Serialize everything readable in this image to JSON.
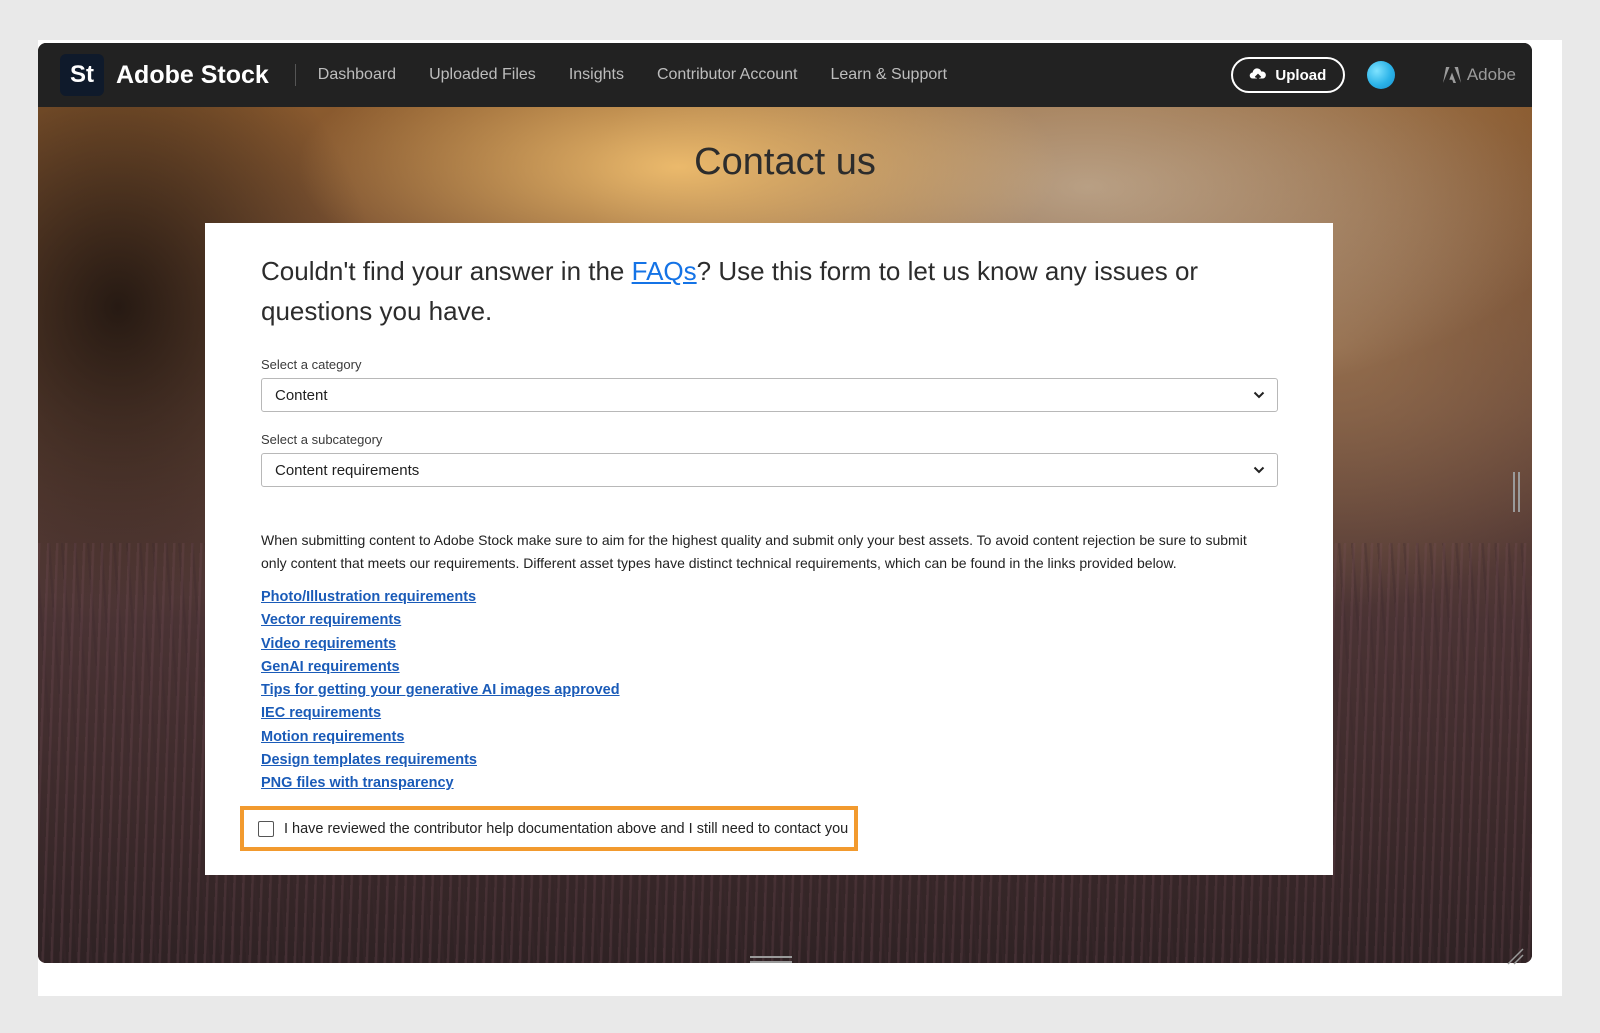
{
  "header": {
    "logo_text": "St",
    "brand": "Adobe Stock",
    "nav": [
      "Dashboard",
      "Uploaded Files",
      "Insights",
      "Contributor Account",
      "Learn & Support"
    ],
    "upload_label": "Upload",
    "adobe_label": "Adobe"
  },
  "page": {
    "title": "Contact us"
  },
  "form": {
    "intro_before": "Couldn't find your answer in the ",
    "intro_link": "FAQs",
    "intro_after": "? Use this form to let us know any issues or questions you have.",
    "category_label": "Select a category",
    "category_value": "Content",
    "subcategory_label": "Select a subcategory",
    "subcategory_value": "Content requirements",
    "description": "When submitting content to Adobe Stock make sure to aim for the highest quality and submit only your best assets. To avoid content rejection be sure to submit only content that meets our requirements. Different asset types have distinct technical requirements, which can be found in the links provided below.",
    "links": [
      "Photo/Illustration requirements",
      "Vector requirements",
      "Video requirements",
      "GenAI requirements",
      "Tips for getting your generative AI images approved",
      "IEC requirements",
      "Motion requirements",
      "Design templates requirements",
      "PNG files with transparency"
    ],
    "confirm_label": "I have reviewed the contributor help documentation above and I still need to contact you",
    "confirm_checked": false
  },
  "colors": {
    "header_bg": "#222222",
    "link": "#1a5bb8",
    "highlight": "#f29a2e"
  }
}
